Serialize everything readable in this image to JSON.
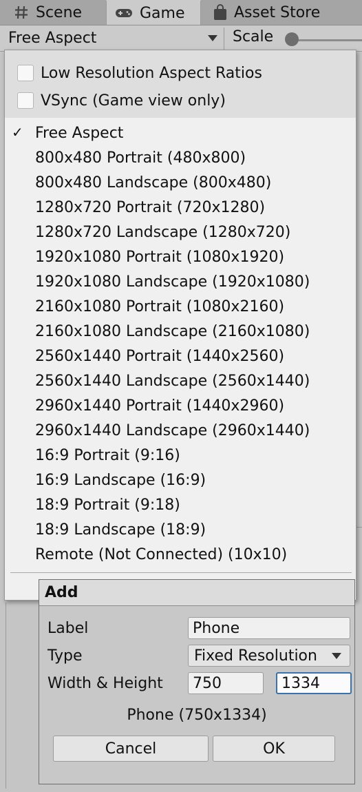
{
  "tabs": [
    {
      "label": "Scene",
      "icon": "hash-grid-icon"
    },
    {
      "label": "Game",
      "icon": "gamepad-icon"
    },
    {
      "label": "Asset Store",
      "icon": "shopping-bag-icon"
    }
  ],
  "toolbar": {
    "aspect_value": "Free Aspect",
    "scale_label": "Scale"
  },
  "menu": {
    "options": [
      {
        "label": "Low Resolution Aspect Ratios",
        "checked": false
      },
      {
        "label": "VSync (Game view only)",
        "checked": false
      }
    ],
    "items": [
      {
        "label": "Free Aspect",
        "selected": true
      },
      {
        "label": "800x480 Portrait (480x800)"
      },
      {
        "label": "800x480 Landscape (800x480)"
      },
      {
        "label": "1280x720 Portrait (720x1280)"
      },
      {
        "label": "1280x720 Landscape (1280x720)"
      },
      {
        "label": "1920x1080 Portrait (1080x1920)"
      },
      {
        "label": "1920x1080 Landscape (1920x1080)"
      },
      {
        "label": "2160x1080 Portrait (1080x2160)"
      },
      {
        "label": "2160x1080 Landscape (2160x1080)"
      },
      {
        "label": "2560x1440 Portrait (1440x2560)"
      },
      {
        "label": "2560x1440 Landscape (2560x1440)"
      },
      {
        "label": "2960x1440 Portrait (1440x2960)"
      },
      {
        "label": "2960x1440 Landscape (2960x1440)"
      },
      {
        "label": "16:9 Portrait (9:16)"
      },
      {
        "label": "16:9 Landscape (16:9)"
      },
      {
        "label": "18:9 Portrait (9:18)"
      },
      {
        "label": "18:9 Landscape (18:9)"
      },
      {
        "label": "Remote (Not Connected) (10x10)"
      }
    ]
  },
  "add_popup": {
    "title": "Add",
    "label_field_label": "Label",
    "label_value": "Phone",
    "type_field_label": "Type",
    "type_value": "Fixed Resolution",
    "size_field_label": "Width & Height",
    "width_value": "750",
    "height_value": "1334",
    "preview_text": "Phone (750x1334)",
    "cancel_label": "Cancel",
    "ok_label": "OK"
  },
  "colors": {
    "focus_border": "#3a72b0",
    "menu_bg": "#f0f0f0",
    "panel_bg": "#c8c8c8"
  }
}
